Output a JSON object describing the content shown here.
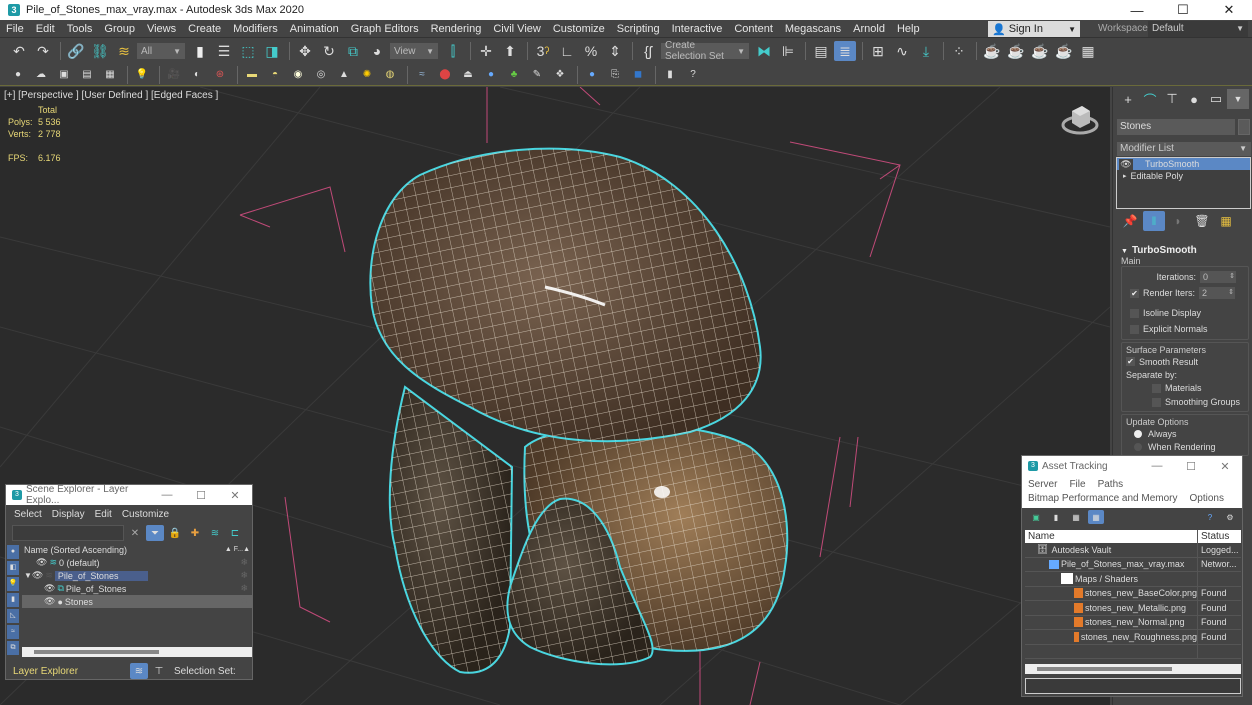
{
  "window": {
    "title": "Pile_of_Stones_max_vray.max - Autodesk 3ds Max 2020",
    "app_icon": "3",
    "controls": {
      "minimize": "—",
      "maximize": "☐",
      "close": "✕"
    }
  },
  "menubar": {
    "items": [
      "File",
      "Edit",
      "Tools",
      "Group",
      "Views",
      "Create",
      "Modifiers",
      "Animation",
      "Graph Editors",
      "Rendering",
      "Civil View",
      "Customize",
      "Scripting",
      "Interactive",
      "Content",
      "Megascans",
      "Arnold",
      "Help"
    ],
    "sign_in": "Sign In",
    "workspaces_label": "Workspaces:",
    "workspace_value": "Default"
  },
  "toolbar_main": {
    "selection_filter": "All",
    "reference_coord": "View",
    "named_selection": "Create Selection Set",
    "snap_3": "3"
  },
  "viewport": {
    "label": "[+] [Perspective ] [User Defined ] [Edged Faces ]",
    "stats": {
      "header": "Total",
      "polys_label": "Polys:",
      "polys_value": "5 536",
      "verts_label": "Verts:",
      "verts_value": "2 778",
      "fps_label": "FPS:",
      "fps_value": "6.176"
    },
    "selection_color": "#49d6e0",
    "grid_color": "#3a3a3a",
    "bbox_color": "#d85a8a"
  },
  "command_panel": {
    "object_name": "Stones",
    "modifier_list": "Modifier List",
    "stack": [
      {
        "label": "TurboSmooth",
        "selected": true
      },
      {
        "label": "Editable Poly",
        "selected": false
      }
    ],
    "rollout": {
      "title": "TurboSmooth",
      "main_group": "Main",
      "iterations_label": "Iterations:",
      "iterations_value": "0",
      "render_iters_label": "Render Iters:",
      "render_iters_value": "2",
      "render_iters_checked": true,
      "isoline_display": "Isoline Display",
      "explicit_normals": "Explicit Normals",
      "surface_group": "Surface Parameters",
      "smooth_result": "Smooth Result",
      "smooth_result_checked": true,
      "separate_by": "Separate by:",
      "materials": "Materials",
      "smoothing_groups": "Smoothing Groups",
      "update_group": "Update Options",
      "always": "Always",
      "when_rendering": "When Rendering",
      "selected_update": "Always"
    }
  },
  "scene_explorer": {
    "title": "Scene Explorer - Layer Explo...",
    "menu": [
      "Select",
      "Display",
      "Edit",
      "Customize"
    ],
    "column_name": "Name (Sorted Ascending)",
    "column_freeze": "▲ F...▲",
    "rows": [
      {
        "label": "0 (default)",
        "indent": 1
      },
      {
        "label": "Pile_of_Stones",
        "indent": 0,
        "highlight": true
      },
      {
        "label": "Pile_of_Stones",
        "indent": 2
      },
      {
        "label": "Stones",
        "indent": 2,
        "selected": true
      }
    ],
    "explorer_type": "Layer Explorer",
    "selection_set_label": "Selection Set:"
  },
  "asset_tracking": {
    "title": "Asset Tracking",
    "menu_row1": [
      "Server",
      "File",
      "Paths"
    ],
    "menu_row2": [
      "Bitmap Performance and Memory",
      "Options"
    ],
    "columns": [
      "Name",
      "Status"
    ],
    "rows": [
      {
        "name": "Autodesk Vault",
        "status": "Logged...",
        "indent": 1,
        "icon": "vault"
      },
      {
        "name": "Pile_of_Stones_max_vray.max",
        "status": "Networ...",
        "indent": 2,
        "icon": "max"
      },
      {
        "name": "Maps / Shaders",
        "status": "",
        "indent": 3,
        "icon": "folder"
      },
      {
        "name": "stones_new_BaseColor.png",
        "status": "Found",
        "indent": 4,
        "icon": "png"
      },
      {
        "name": "stones_new_Metallic.png",
        "status": "Found",
        "indent": 4,
        "icon": "png"
      },
      {
        "name": "stones_new_Normal.png",
        "status": "Found",
        "indent": 4,
        "icon": "png"
      },
      {
        "name": "stones_new_Roughness.png",
        "status": "Found",
        "indent": 4,
        "icon": "png"
      },
      {
        "name": "",
        "status": "",
        "indent": 0,
        "icon": ""
      }
    ]
  }
}
